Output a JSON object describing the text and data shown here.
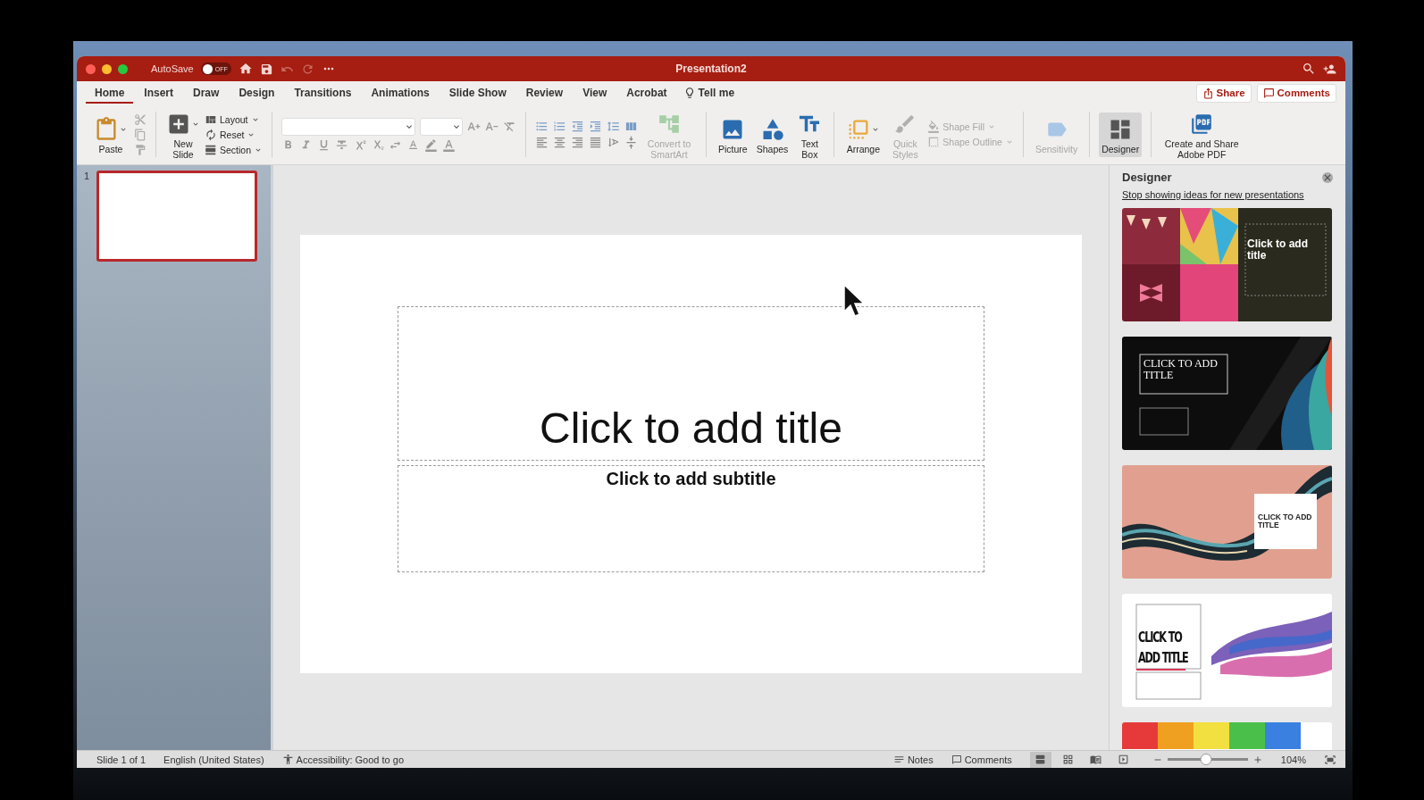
{
  "window": {
    "title": "Presentation2"
  },
  "autosave": {
    "label": "AutoSave",
    "state": "OFF",
    "on": false
  },
  "tabs": [
    {
      "label": "Home",
      "selected": true
    },
    {
      "label": "Insert",
      "selected": false
    },
    {
      "label": "Draw",
      "selected": false
    },
    {
      "label": "Design",
      "selected": false
    },
    {
      "label": "Transitions",
      "selected": false
    },
    {
      "label": "Animations",
      "selected": false
    },
    {
      "label": "Slide Show",
      "selected": false
    },
    {
      "label": "Review",
      "selected": false
    },
    {
      "label": "View",
      "selected": false
    },
    {
      "label": "Acrobat",
      "selected": false
    }
  ],
  "tell_me": {
    "label": "Tell me"
  },
  "share_button": {
    "label": "Share"
  },
  "comments_button": {
    "label": "Comments"
  },
  "ribbon": {
    "paste": {
      "label": "Paste"
    },
    "new_slide": {
      "label": "New Slide"
    },
    "slide_buttons": [
      {
        "label": "Layout"
      },
      {
        "label": "Reset"
      },
      {
        "label": "Section"
      }
    ],
    "convert": {
      "label": "Convert to SmartArt",
      "disabled": true
    },
    "insert_buttons": [
      {
        "label": "Picture",
        "disabled": false
      },
      {
        "label": "Shapes",
        "disabled": false
      },
      {
        "label": "Text Box",
        "disabled": false
      }
    ],
    "arrange": {
      "label": "Arrange",
      "disabled": false
    },
    "quick_styles": {
      "label": "Quick Styles",
      "disabled": true
    },
    "shape_buttons": [
      {
        "label": "Shape Fill",
        "disabled": true
      },
      {
        "label": "Shape Outline",
        "disabled": true
      }
    ],
    "sensitivity": {
      "label": "Sensitivity",
      "disabled": true
    },
    "designer": {
      "label": "Designer",
      "selected": true
    },
    "adobe": {
      "label": "Create and Share Adobe PDF"
    }
  },
  "thumbnails": [
    {
      "number": "1",
      "selected": true
    }
  ],
  "slide": {
    "title_placeholder": "Click to add title",
    "subtitle_placeholder": "Click to add subtitle"
  },
  "designer": {
    "title": "Designer",
    "link": "Stop showing ideas for new presentations",
    "designs": [
      {
        "kind": "bunting",
        "title": "Click to add title"
      },
      {
        "kind": "dark",
        "title": "CLICK TO ADD TITLE"
      },
      {
        "kind": "wave",
        "title": "CLICK TO ADD TITLE"
      },
      {
        "kind": "ink",
        "title": "CLICK TO ADD TITLE"
      },
      {
        "kind": "rainbow"
      }
    ]
  },
  "status_bar": {
    "slide": "Slide 1 of 1",
    "language": "English (United States)",
    "accessibility": "Accessibility: Good to go",
    "notes": "Notes",
    "comments": "Comments",
    "views": [
      {
        "selected": true
      },
      {
        "selected": false
      },
      {
        "selected": false
      },
      {
        "selected": false
      }
    ],
    "zoom": {
      "level": 0.48,
      "reading": "104%"
    }
  }
}
